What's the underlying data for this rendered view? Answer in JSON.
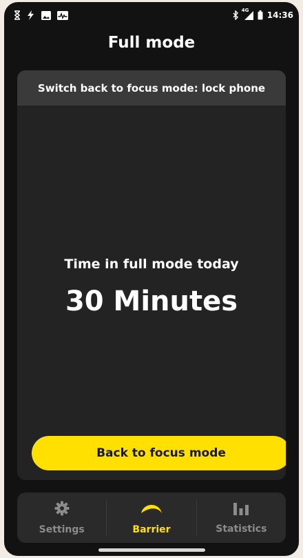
{
  "status_bar": {
    "time": "14:36",
    "network_type": "4G",
    "icons": [
      "hourglass-icon",
      "bolt-icon",
      "image-icon",
      "activity-icon",
      "bluetooth-icon",
      "signal-icon",
      "battery-icon"
    ]
  },
  "header": {
    "title": "Full mode"
  },
  "card": {
    "banner": "Switch back to focus mode: lock phone",
    "label": "Time in full mode today",
    "value": "30 Minutes",
    "button_label": "Back to focus mode"
  },
  "tabs": [
    {
      "label": "Settings",
      "icon": "gear-icon",
      "active": false
    },
    {
      "label": "Barrier",
      "icon": "barrier-icon",
      "active": true
    },
    {
      "label": "Statistics",
      "icon": "bar-chart-icon",
      "active": false
    }
  ],
  "colors": {
    "accent": "#ffe000",
    "background": "#121212",
    "card": "#232323",
    "card_header": "#3a3a3a",
    "tabbar": "#2a2a2a",
    "inactive_tab": "#8c8c8c"
  }
}
